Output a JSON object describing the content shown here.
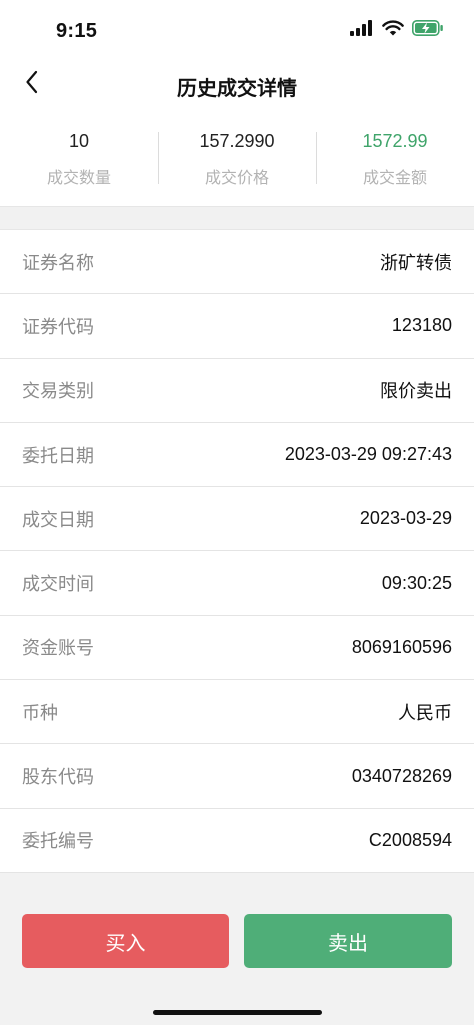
{
  "status_bar": {
    "time": "9:15"
  },
  "nav": {
    "title": "历史成交详情"
  },
  "summary": [
    {
      "value": "10",
      "label": "成交数量"
    },
    {
      "value": "157.2990",
      "label": "成交价格"
    },
    {
      "value": "1572.99",
      "label": "成交金额"
    }
  ],
  "details": [
    {
      "label": "证券名称",
      "value": "浙矿转债"
    },
    {
      "label": "证券代码",
      "value": "123180"
    },
    {
      "label": "交易类别",
      "value": "限价卖出"
    },
    {
      "label": "委托日期",
      "value": "2023-03-29 09:27:43"
    },
    {
      "label": "成交日期",
      "value": "2023-03-29"
    },
    {
      "label": "成交时间",
      "value": "09:30:25"
    },
    {
      "label": "资金账号",
      "value": "8069160596"
    },
    {
      "label": "币种",
      "value": "人民币"
    },
    {
      "label": "股东代码",
      "value": "0340728269"
    },
    {
      "label": "委托编号",
      "value": "C2008594"
    }
  ],
  "actions": {
    "buy_label": "买入",
    "sell_label": "卖出"
  },
  "colors": {
    "amount_green": "#3fa46a",
    "buy_red": "#e65c5f",
    "sell_green": "#4fae78"
  },
  "icons": {
    "back": "chevron-left-icon",
    "signal": "signal-icon",
    "wifi": "wifi-icon",
    "battery": "battery-charging-icon"
  }
}
